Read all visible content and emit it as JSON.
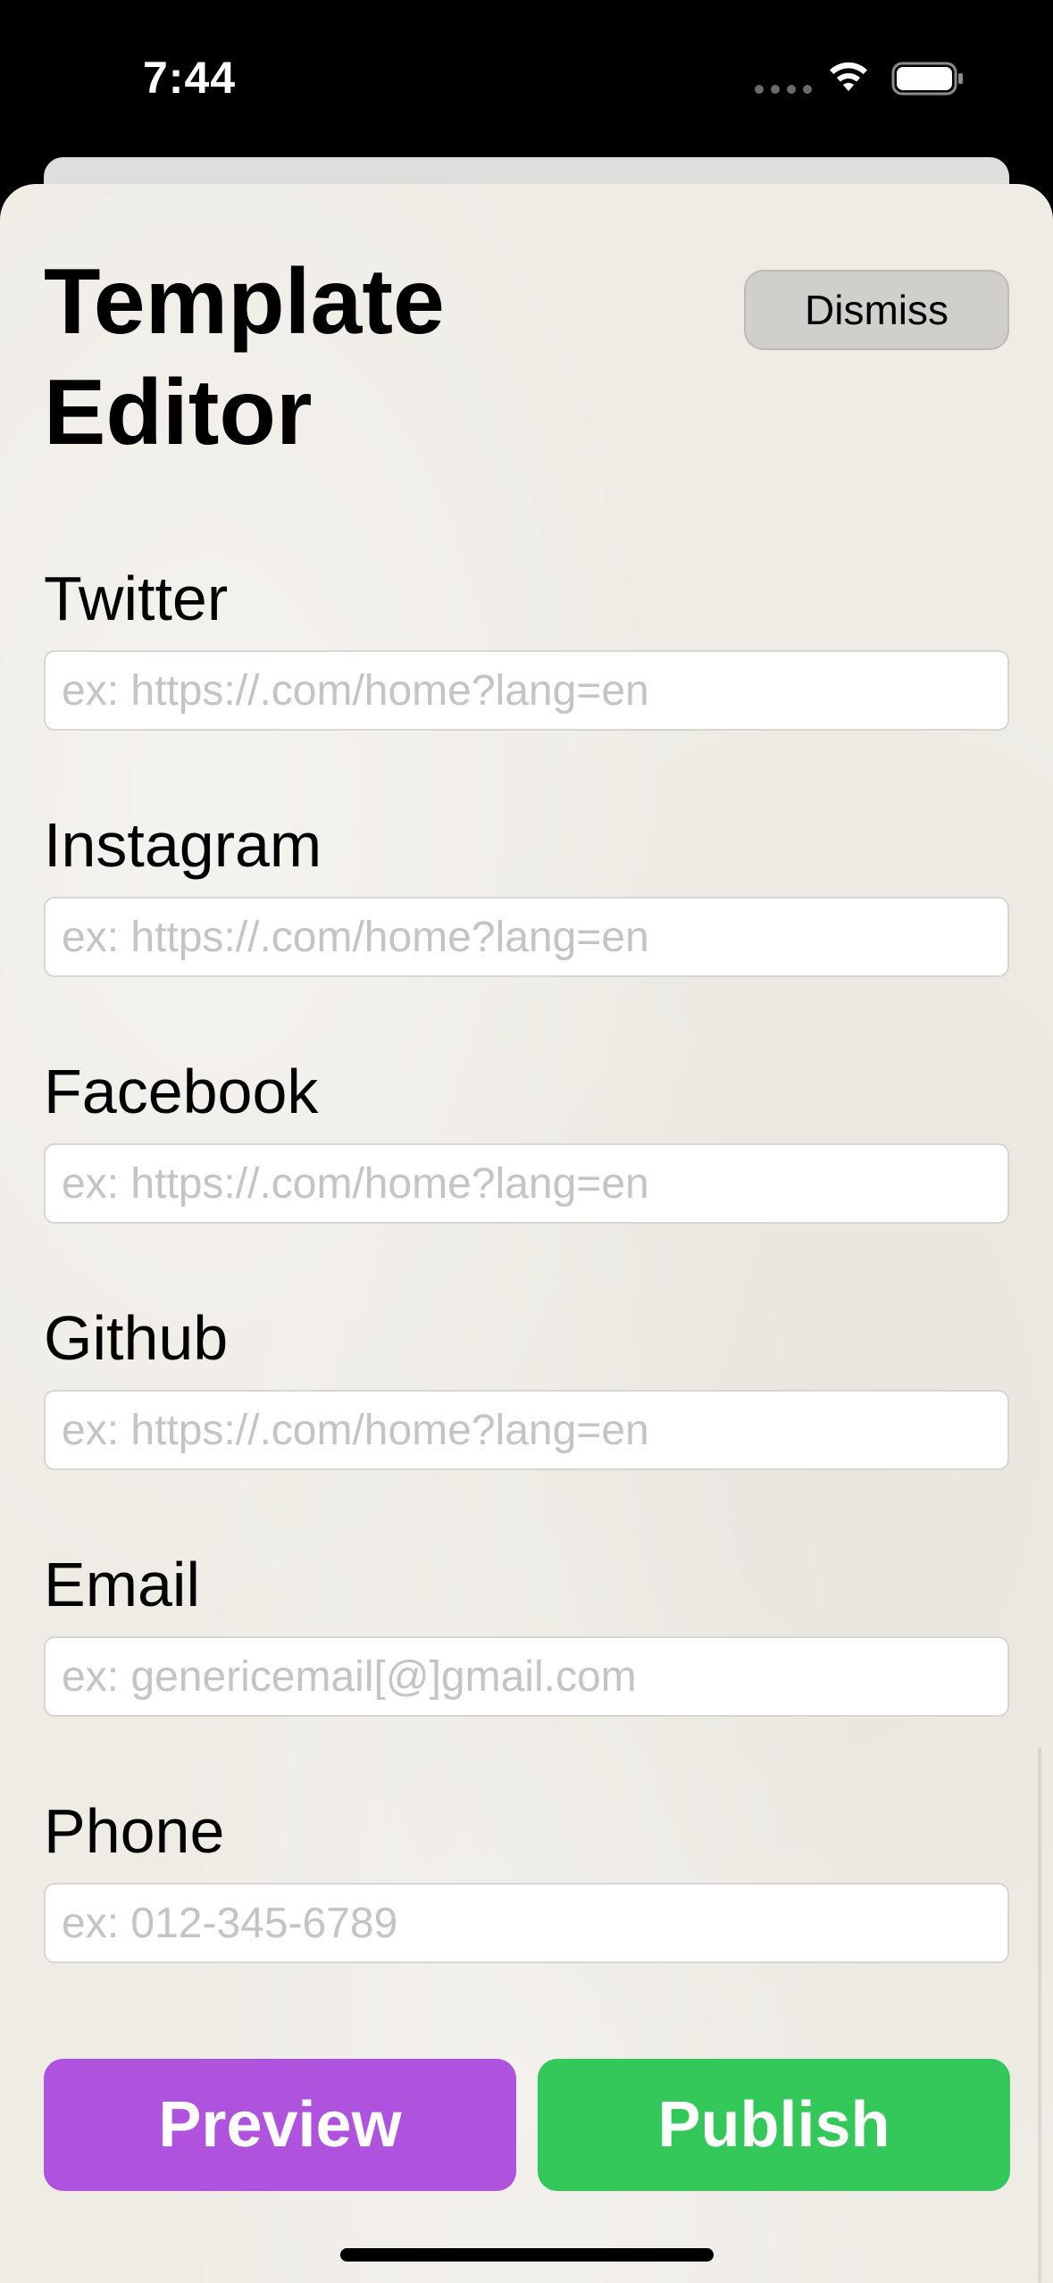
{
  "status_bar": {
    "time": "7:44"
  },
  "header": {
    "title": "Template Editor",
    "dismiss_label": "Dismiss"
  },
  "fields": {
    "twitter": {
      "label": "Twitter",
      "value": "",
      "placeholder": "ex: https://.com/home?lang=en"
    },
    "instagram": {
      "label": "Instagram",
      "value": "",
      "placeholder": "ex: https://.com/home?lang=en"
    },
    "facebook": {
      "label": "Facebook",
      "value": "",
      "placeholder": "ex: https://.com/home?lang=en"
    },
    "github": {
      "label": "Github",
      "value": "",
      "placeholder": "ex: https://.com/home?lang=en"
    },
    "email": {
      "label": "Email",
      "value": "",
      "placeholder": "ex: genericemail[@]gmail.com"
    },
    "phone": {
      "label": "Phone",
      "value": "",
      "placeholder": "ex: 012-345-6789"
    }
  },
  "actions": {
    "preview_label": "Preview",
    "publish_label": "Publish"
  },
  "colors": {
    "preview": "#af52de",
    "publish": "#34c759",
    "sheet_background": "#efece6"
  },
  "icons": [
    "wifi-icon",
    "battery-icon",
    "signal-dots-icon"
  ]
}
